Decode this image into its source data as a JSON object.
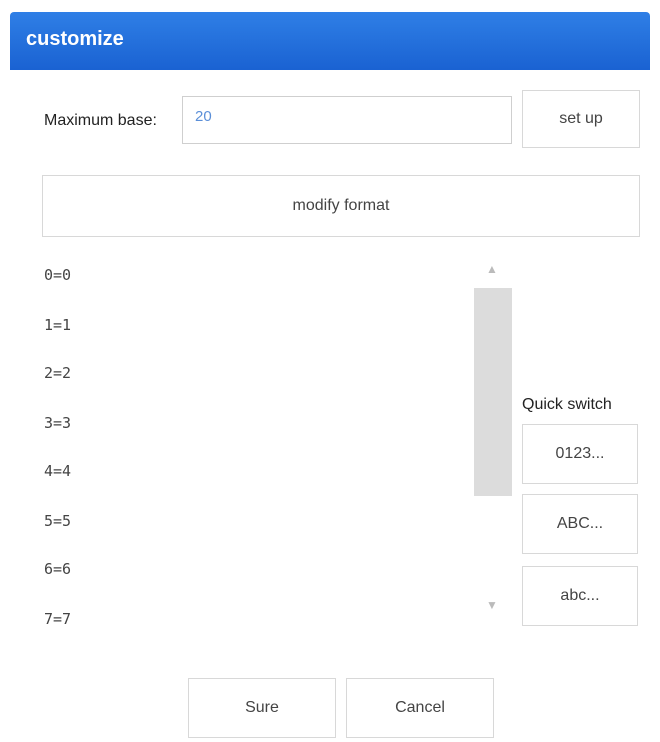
{
  "window": {
    "title": "customize"
  },
  "max_base": {
    "label": "Maximum base:",
    "value": "20",
    "setup_label": "set up"
  },
  "modify_format_label": "modify format",
  "mapping_list": [
    "0=0",
    "1=1",
    "2=2",
    "3=3",
    "4=4",
    "5=5",
    "6=6",
    "7=7"
  ],
  "quick_switch": {
    "label": "Quick switch",
    "options": [
      "0123...",
      "ABC...",
      "abc..."
    ]
  },
  "footer": {
    "sure_label": "Sure",
    "cancel_label": "Cancel"
  },
  "colors": {
    "titlebar": "#1f6fe0",
    "input_text": "#5b8fd8"
  }
}
